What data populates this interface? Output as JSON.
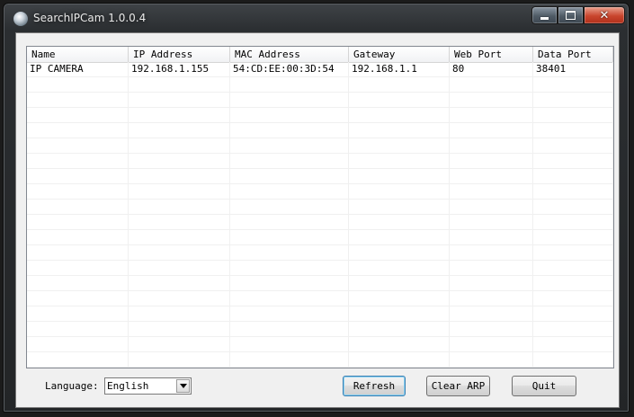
{
  "window": {
    "title": "SearchIPCam 1.0.0.4",
    "caption_buttons": {
      "minimize": "minimize-icon",
      "maximize": "maximize-icon",
      "close": "close-icon"
    }
  },
  "table": {
    "columns": [
      "Name",
      "IP Address",
      "MAC Address",
      "Gateway",
      "Web Port",
      "Data Port"
    ],
    "rows": [
      [
        "IP CAMERA",
        "192.168.1.155",
        "54:CD:EE:00:3D:54",
        "192.168.1.1",
        "80",
        "38401"
      ]
    ]
  },
  "footer": {
    "language_label": "Language:",
    "language_value": "English",
    "refresh_label": "Refresh",
    "clear_arp_label": "Clear ARP",
    "quit_label": "Quit"
  },
  "colors": {
    "title_text": "#e9e9e9",
    "close_button": "#c9452d",
    "default_button_border": "#3c7fb1"
  }
}
